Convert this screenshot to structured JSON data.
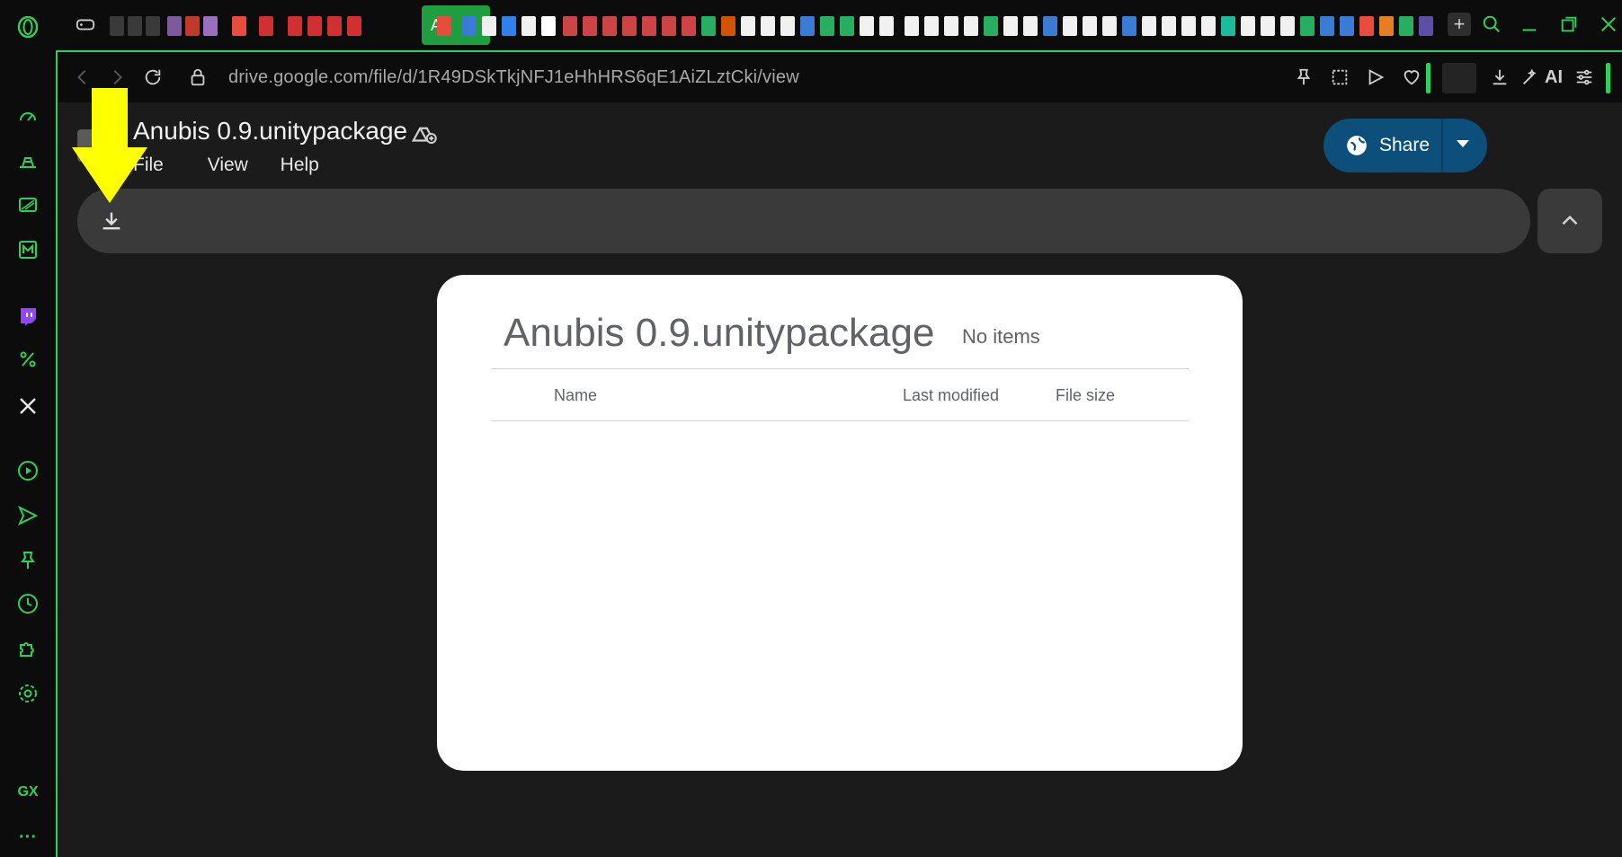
{
  "browser": {
    "url": "drive.google.com/file/d/1R49DSkTkjNFJ1eHhHRS6qE1AiZLztCki/view",
    "active_tab_label": "An",
    "new_tab_label": "+",
    "ai_label": "AI",
    "sidebar_bottom_label": "GX",
    "sidebar_more": "···"
  },
  "drive": {
    "file_title": "Anubis 0.9.unitypackage",
    "menus": {
      "file": "File",
      "view": "View",
      "help": "Help"
    },
    "share_label": "Share"
  },
  "preview": {
    "title": "Anubis 0.9.unitypackage",
    "count": "No items",
    "columns": {
      "name": "Name",
      "last_modified": "Last modified",
      "file_size": "File size"
    }
  },
  "colors": {
    "accent": "#2fd05a",
    "share": "#0b4f7a",
    "annotation_arrow": "#ffff00"
  }
}
